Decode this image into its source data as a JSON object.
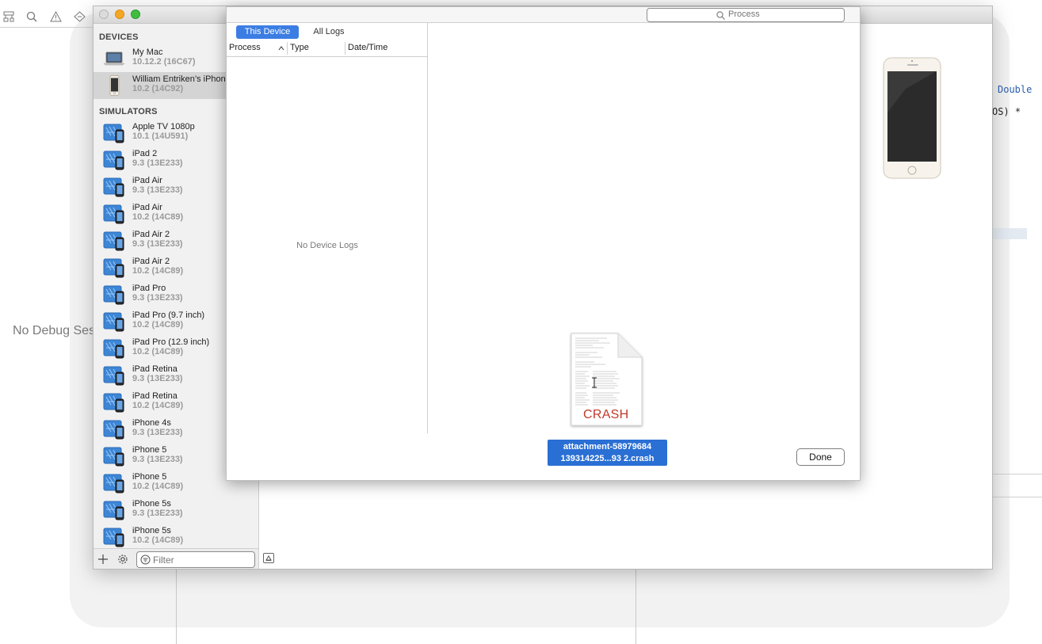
{
  "devices_header": "DEVICES",
  "simulators_header": "SIMULATORS",
  "devices": [
    {
      "name": "My Mac",
      "version": "10.12.2 (16C67)",
      "icon": "mac-icon"
    },
    {
      "name": "William Entriken’s iPhone",
      "version": "10.2 (14C92)",
      "icon": "iphone-icon",
      "selected": true
    }
  ],
  "simulators": [
    {
      "name": "Apple TV 1080p",
      "version": "10.1 (14U591)"
    },
    {
      "name": "iPad 2",
      "version": "9.3 (13E233)"
    },
    {
      "name": "iPad Air",
      "version": "9.3 (13E233)"
    },
    {
      "name": "iPad Air",
      "version": "10.2 (14C89)"
    },
    {
      "name": "iPad Air 2",
      "version": "9.3 (13E233)"
    },
    {
      "name": "iPad Air 2",
      "version": "10.2 (14C89)"
    },
    {
      "name": "iPad Pro",
      "version": "9.3 (13E233)"
    },
    {
      "name": "iPad Pro (9.7 inch)",
      "version": "10.2 (14C89)"
    },
    {
      "name": "iPad Pro (12.9 inch)",
      "version": "10.2 (14C89)"
    },
    {
      "name": "iPad Retina",
      "version": "9.3 (13E233)"
    },
    {
      "name": "iPad Retina",
      "version": "10.2 (14C89)"
    },
    {
      "name": "iPhone 4s",
      "version": "9.3 (13E233)"
    },
    {
      "name": "iPhone 5",
      "version": "9.3 (13E233)"
    },
    {
      "name": "iPhone 5",
      "version": "10.2 (14C89)"
    },
    {
      "name": "iPhone 5s",
      "version": "9.3 (13E233)"
    },
    {
      "name": "iPhone 5s",
      "version": "10.2 (14C89)"
    }
  ],
  "filter": {
    "placeholder": "Filter"
  },
  "background": {
    "debug_text": "No Debug Session",
    "code_1": "Double",
    "code_2": "OS) *"
  },
  "logs_sheet": {
    "search_placeholder": "Process",
    "tab_this_device": "This Device",
    "tab_all_logs": "All Logs",
    "columns": [
      "Process",
      "Type",
      "Date/Time"
    ],
    "empty_text": "No Device Logs",
    "crash_badge": "CRASH",
    "file_line_1": "attachment-58979684",
    "file_line_2": "139314225...93 2.crash",
    "done_label": "Done"
  },
  "colors": {
    "accent": "#3b7de3",
    "selection": "#2a6fd4",
    "crash": "#c0392b"
  }
}
